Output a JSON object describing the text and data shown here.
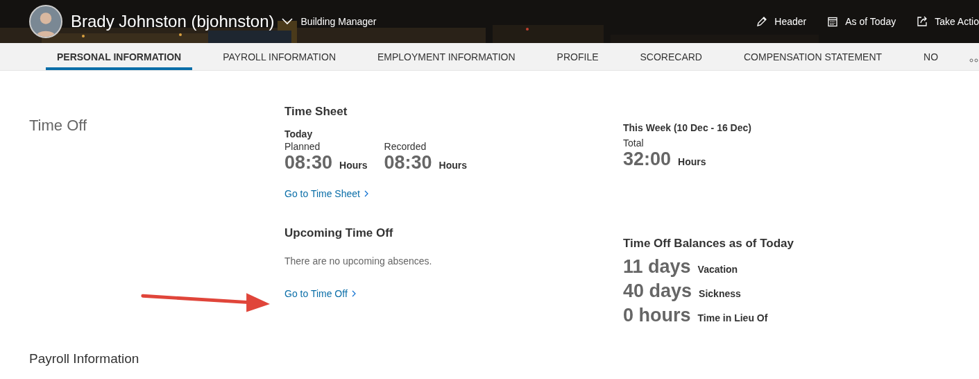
{
  "header": {
    "name": "Brady Johnston (bjohnston)",
    "role": "Building Manager",
    "actions": [
      {
        "kind": "edit",
        "label": "Header"
      },
      {
        "kind": "calendar",
        "label": "As of Today"
      },
      {
        "kind": "share",
        "label": "Take Actio"
      }
    ]
  },
  "tabs": [
    {
      "label": "PERSONAL INFORMATION",
      "selected": true
    },
    {
      "label": "PAYROLL INFORMATION",
      "selected": false
    },
    {
      "label": "EMPLOYMENT INFORMATION",
      "selected": false
    },
    {
      "label": "PROFILE",
      "selected": false
    },
    {
      "label": "SCORECARD",
      "selected": false
    },
    {
      "label": "COMPENSATION STATEMENT",
      "selected": false
    },
    {
      "label": "NO",
      "selected": false
    }
  ],
  "section": {
    "title": "Time Off"
  },
  "time_sheet": {
    "title": "Time Sheet",
    "today": "Today",
    "entries": [
      {
        "label": "Planned",
        "value": "08:30",
        "unit": "Hours"
      },
      {
        "label": "Recorded",
        "value": "08:30",
        "unit": "Hours"
      }
    ],
    "link": "Go to Time Sheet"
  },
  "this_week": {
    "title": "This Week (10 Dec - 16 Dec)",
    "label": "Total",
    "value": "32:00",
    "unit": "Hours"
  },
  "upcoming": {
    "title": "Upcoming Time Off",
    "message": "There are no upcoming absences.",
    "link": "Go to Time Off"
  },
  "balances": {
    "title": "Time Off Balances as of Today",
    "items": [
      {
        "value": "11 days",
        "label": "Vacation"
      },
      {
        "value": "40 days",
        "label": "Sickness"
      },
      {
        "value": "0 hours",
        "label": "Time in Lieu Of"
      }
    ]
  },
  "next_section": {
    "title": "Payroll Information"
  }
}
